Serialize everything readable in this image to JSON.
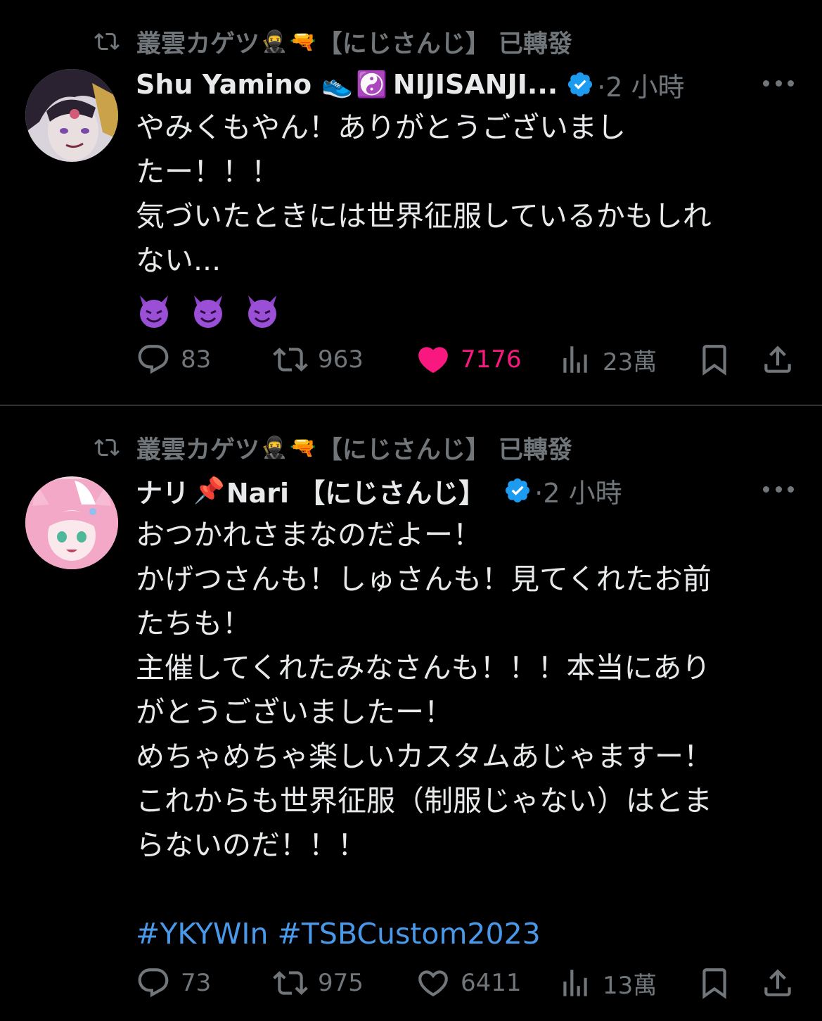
{
  "tweets": [
    {
      "retweeted_by": "叢雲カゲツ",
      "retweet_label": "【にじさんじ】 已轉發",
      "display_name": "Shu Yamino",
      "handle_part": "NIJISANJI...",
      "time": "·2 小時",
      "lines": [
        "やみくもやん！ありがとうございまし",
        "たー！！！",
        "気づいたときには世界征服しているかもしれ",
        "ない..."
      ],
      "emoji_line": "😈😈😈",
      "stats": {
        "replies": "83",
        "retweets": "963",
        "likes": "7176",
        "views": "23萬"
      },
      "liked": true
    },
    {
      "retweeted_by": "叢雲カゲツ",
      "retweet_label": "【にじさんじ】 已轉發",
      "display_name": "ナリ",
      "handle_part": "Nari 【にじさんじ】",
      "time": "·2 小時",
      "lines": [
        "おつかれさまなのだよー！",
        "かげつさんも！しゅさんも！見てくれたお前",
        "たちも！",
        "主催してくれたみなさんも！！！本当にあり",
        "がとうございましたー！",
        "めちゃめちゃ楽しいカスタムあじゃますー！",
        "これからも世界征服（制服じゃない）はとま",
        "らないのだ！！！"
      ],
      "hashtags": "#YKYWIn #TSBCustom2023",
      "stats": {
        "replies": "73",
        "retweets": "975",
        "likes": "6411",
        "views": "13萬"
      },
      "liked": false
    }
  ],
  "colors": {
    "muted": "#71767b",
    "like": "#f91880",
    "link": "#4a99e9",
    "verified": "#1d9bf0"
  }
}
